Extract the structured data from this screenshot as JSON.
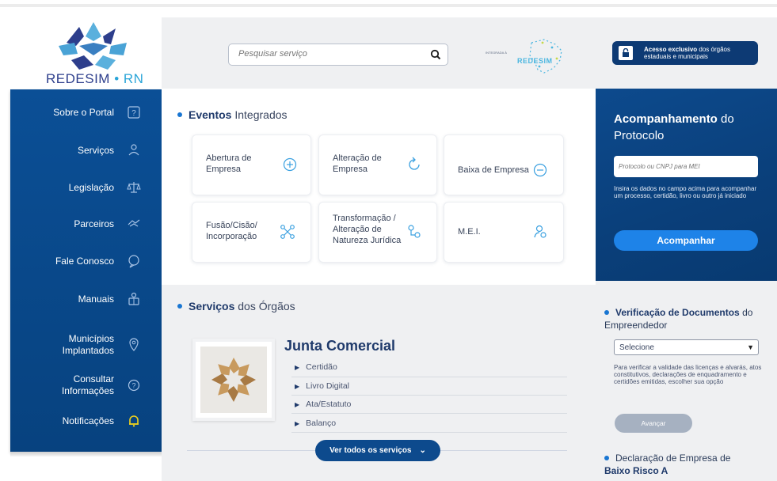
{
  "logo": {
    "text_main": "REDESIM",
    "text_sep": "•",
    "text_state": "RN"
  },
  "sidebar": {
    "items": [
      {
        "label": "Sobre o Portal",
        "icon": "question-icon"
      },
      {
        "label": "Serviços",
        "icon": "person-service-icon"
      },
      {
        "label": "Legislação",
        "icon": "scale-icon"
      },
      {
        "label": "Parceiros",
        "icon": "handshake-icon"
      },
      {
        "label": "Fale Conosco",
        "icon": "chat-icon"
      },
      {
        "label": "Manuais",
        "icon": "manual-icon"
      },
      {
        "label": "Municípios Implantados",
        "icon": "location-pin-icon"
      },
      {
        "label": "Consultar Informações",
        "icon": "info-icon"
      },
      {
        "label": "Notificações",
        "icon": "bell-icon"
      }
    ]
  },
  "search": {
    "placeholder": "Pesquisar serviço"
  },
  "partner_logo": {
    "small_text": "INTEGRADA À",
    "brand": "REDESIM"
  },
  "eventos": {
    "title_bold": "Eventos",
    "title_rest": " Integrados",
    "cards": [
      {
        "label": "Abertura de Empresa",
        "icon": "plus-circle-icon"
      },
      {
        "label": "Alteração de Empresa",
        "icon": "refresh-icon"
      },
      {
        "label": "Baixa de Empresa",
        "icon": "minus-circle-icon"
      },
      {
        "label": "Fusão/Cisão/ Incorporação",
        "icon": "merge-icon"
      },
      {
        "label": "Transformação / Alteração de Natureza Jurídica",
        "icon": "transform-icon"
      },
      {
        "label": "M.E.I.",
        "icon": "mei-icon"
      }
    ]
  },
  "servicos": {
    "title_bold": "Serviços",
    "title_rest": " dos Órgãos",
    "org_title": "Junta Comercial",
    "links": [
      "Certidão",
      "Livro Digital",
      "Ata/Estatuto",
      "Balanço"
    ],
    "more_button": "Ver todos os serviços"
  },
  "acesso": {
    "bold": "Acesso exclusivo",
    "rest": " dos órgãos estaduais e municipais"
  },
  "protocolo": {
    "title_bold": "Acompanhamento",
    "title_rest": " do Protocolo",
    "placeholder": "Protocolo ou CNPJ para MEI",
    "help": "Insira os dados no campo acima para acompanhar um processo, certidão, livro ou outro já iniciado",
    "button": "Acompanhar"
  },
  "verificacao": {
    "title_bold": "Verificação de Documentos",
    "title_rest": " do Empreendedor",
    "select_value": "Selecione",
    "help": "Para verificar a validade das licenças e alvarás, atos constitutivos, declarações de enquadramento e certidões emitidas, escolher sua opção",
    "button": "Avançar"
  },
  "declaracao": {
    "title_rest": "Declaração de Empresa de ",
    "title_bold": "Baixo Risco A"
  },
  "colors": {
    "navy": "#0b4f96",
    "accent": "#1e83e8",
    "dark": "#1f3a6b"
  }
}
